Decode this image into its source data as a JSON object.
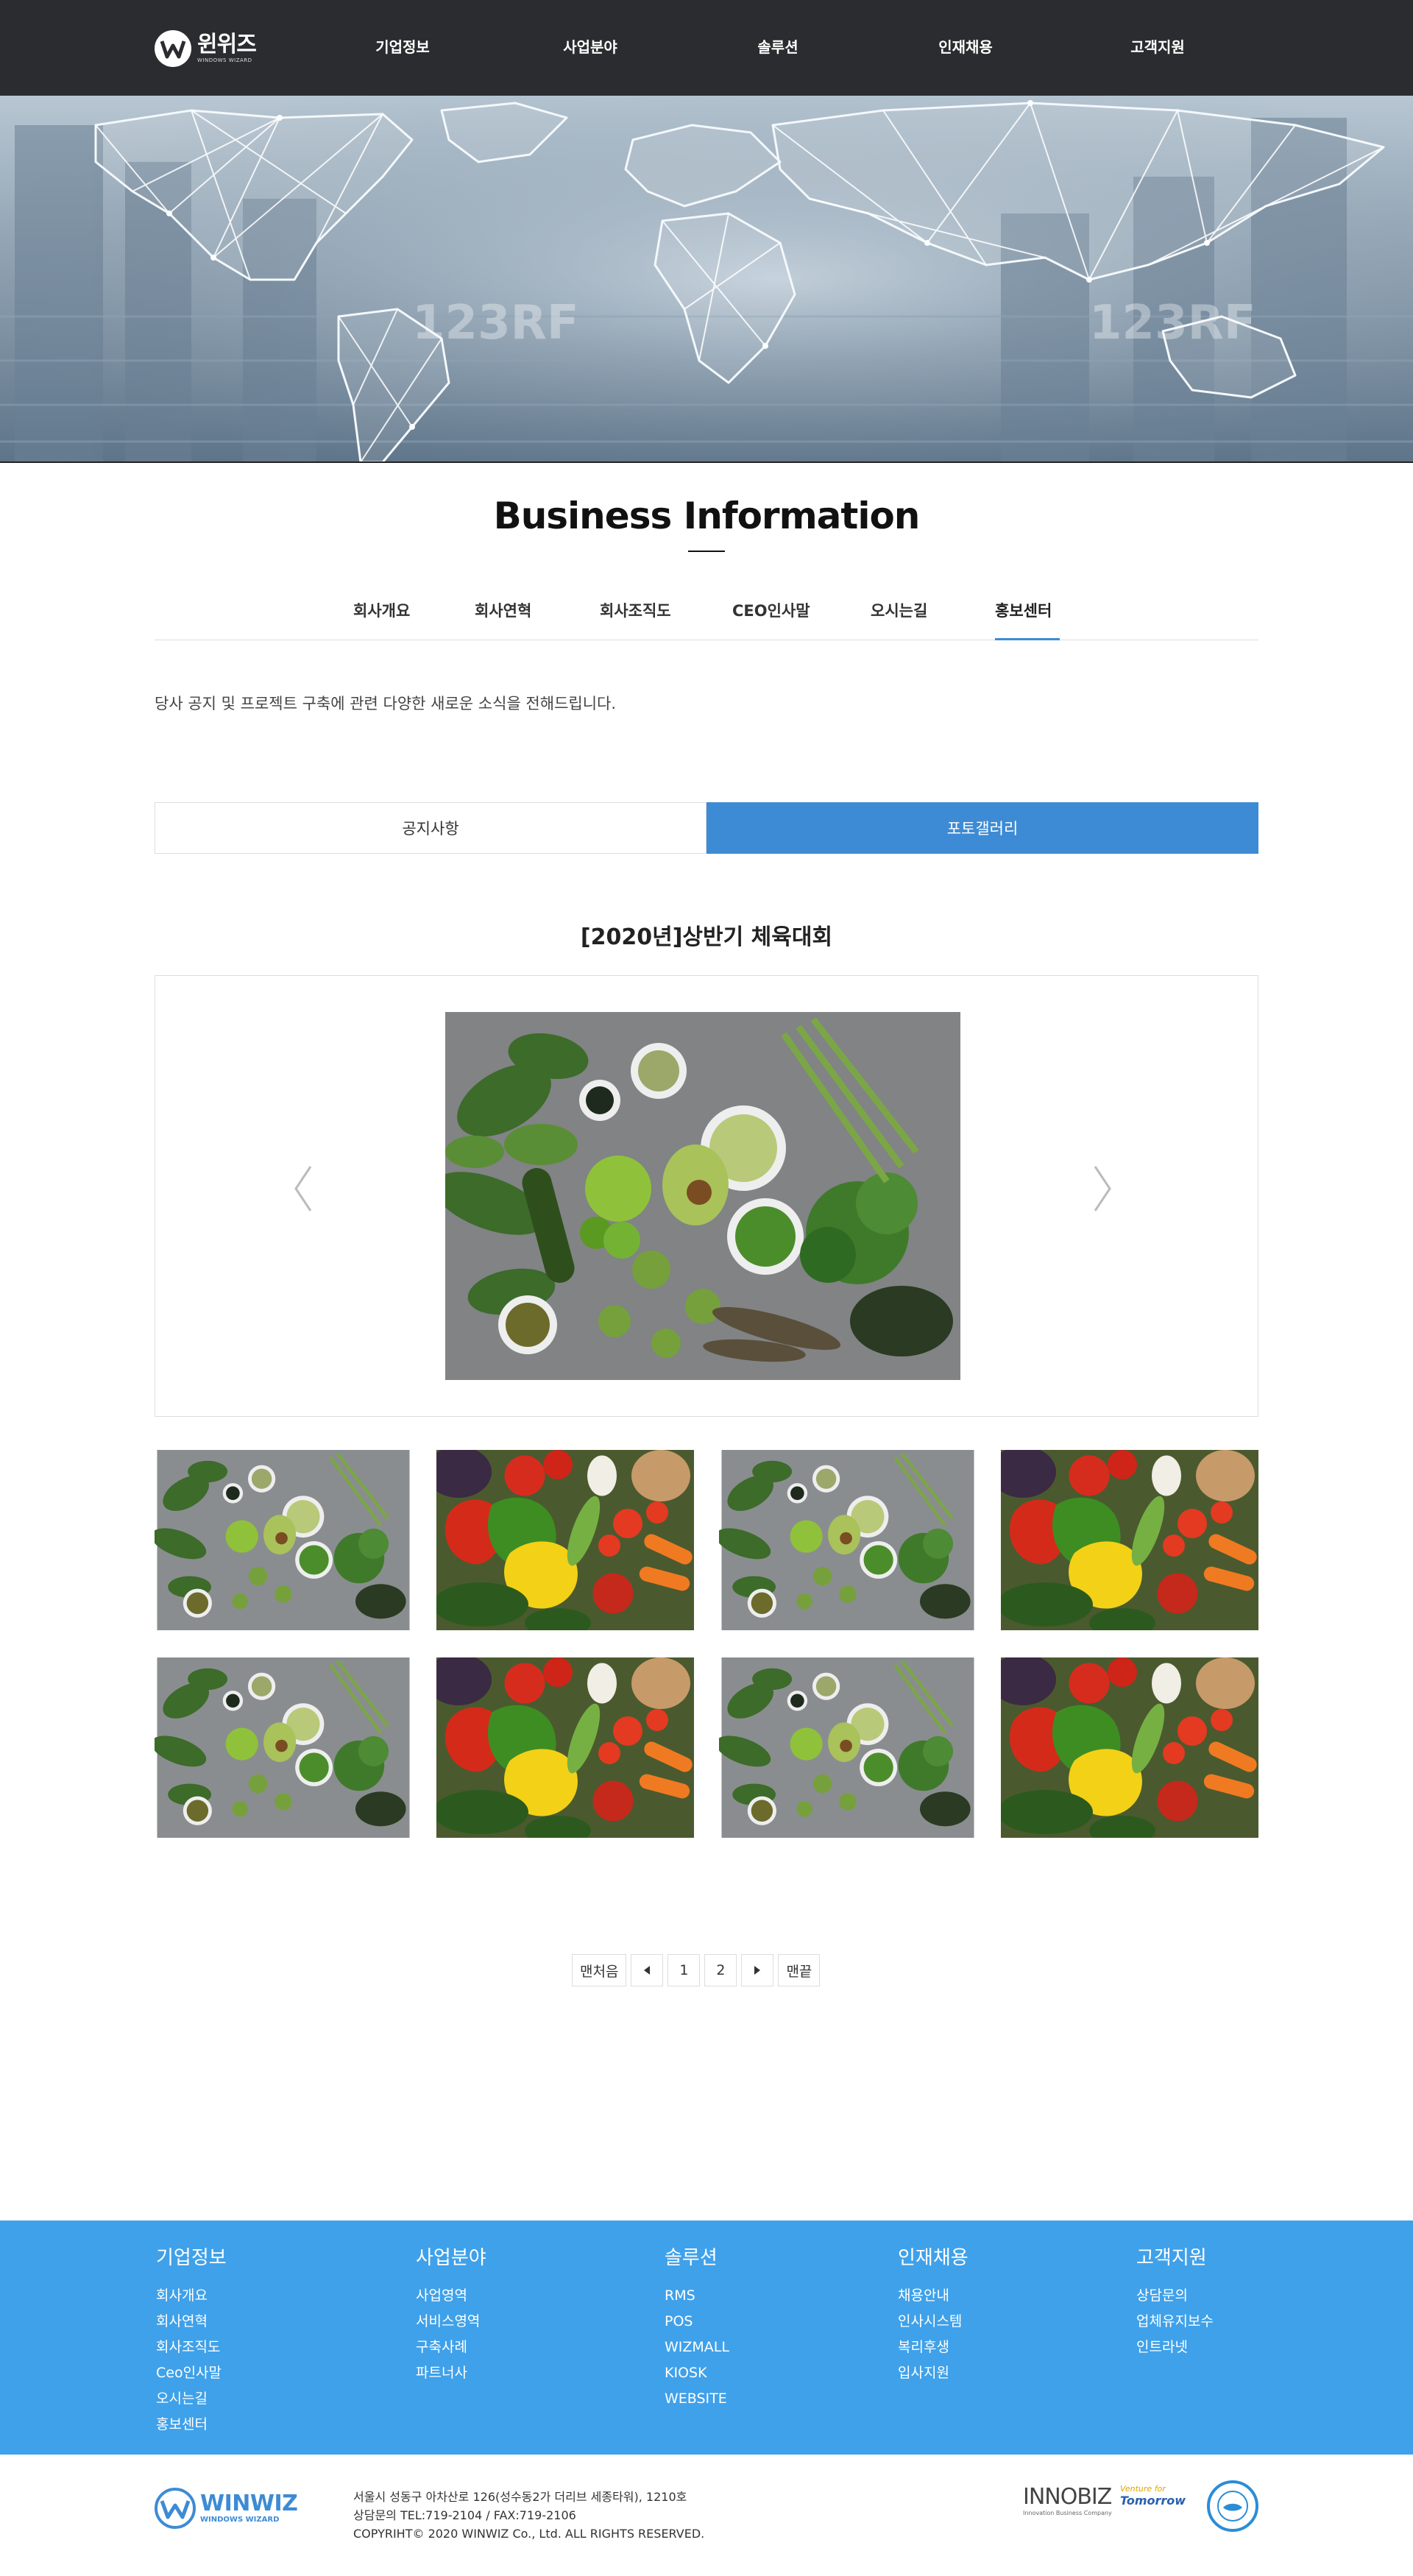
{
  "header": {
    "logo_text": "윈위즈",
    "logo_sub": "WINDOWS WIZARD",
    "nav": [
      {
        "label": "기업정보"
      },
      {
        "label": "사업분야"
      },
      {
        "label": "솔루션"
      },
      {
        "label": "인재채용"
      },
      {
        "label": "고객지원"
      }
    ]
  },
  "hero": {
    "watermark": "123RF"
  },
  "page": {
    "title": "Business Information",
    "subtabs": [
      "회사개요",
      "회사연혁",
      "회사조직도",
      "CEO인사말",
      "오시는길",
      "홍보센터"
    ],
    "active_subtab": "홍보센터",
    "intro": "당사 공지 및 프로젝트 구축에 관련 다양한 새로운 소식을 전해드립니다.",
    "board_tabs": [
      "공지사항",
      "포토갤러리"
    ],
    "active_board_tab": "포토갤러리",
    "post_title": "[2020년]상반기 체육대회"
  },
  "gallery": {
    "prev_icon": "chevron-left-icon",
    "next_icon": "chevron-right-icon",
    "thumbnails": [
      "green-vegetables",
      "colorful-vegetables",
      "green-vegetables",
      "colorful-vegetables",
      "green-vegetables",
      "colorful-vegetables",
      "green-vegetables",
      "colorful-vegetables"
    ]
  },
  "pagination": {
    "first": "맨처음",
    "prev_icon": "triangle-left-icon",
    "pages": [
      "1",
      "2"
    ],
    "next_icon": "triangle-right-icon",
    "last": "맨끝"
  },
  "footer": {
    "columns": [
      {
        "title": "기업정보",
        "items": [
          "회사개요",
          "회사연혁",
          "회사조직도",
          "Ceo인사말",
          "오시는길",
          "홍보센터"
        ]
      },
      {
        "title": "사업분야",
        "items": [
          "사업영역",
          "서비스영역",
          "구축사례",
          "파트너사"
        ]
      },
      {
        "title": "솔루션",
        "items": [
          "RMS",
          "POS",
          "WIZMALL",
          "KIOSK",
          "WEBSITE"
        ]
      },
      {
        "title": "인재채용",
        "items": [
          "채용안내",
          "인사시스템",
          "복리후생",
          "입사지원"
        ]
      },
      {
        "title": "고객지원",
        "items": [
          "상담문의",
          "업체유지보수",
          "인트라넷"
        ]
      }
    ],
    "logo_text": "WINWIZ",
    "logo_sub": "WINDOWS WIZARD",
    "address": "서울시 성동구 아차산로 126(성수동2가 더리브 세종타워), 1210호",
    "contact": "상담문의 TEL:719-2104 / FAX:719-2106",
    "copyright": "COPYRIHT© 2020 WINWIZ Co., Ltd. ALL RIGHTS RESERVED.",
    "cert_innobiz": "INNOBIZ",
    "cert_innobiz_sub": "Innovation Business Company",
    "cert_venture_top": "Venture for",
    "cert_venture_main": "Tomorrow",
    "colors": {
      "primary": "#3fa1ea",
      "accent": "#3d8bd4",
      "header_bg": "#2b2c2f"
    }
  }
}
